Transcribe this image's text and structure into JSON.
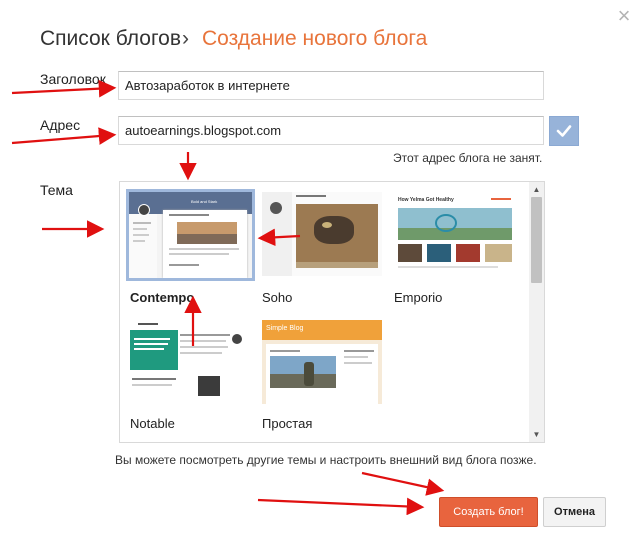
{
  "header": {
    "breadcrumb_root": "Список блогов",
    "separator": "›",
    "current_page": "Создание нового блога",
    "close_symbol": "×"
  },
  "form": {
    "title_label": "Заголовок",
    "title_value": "Автозаработок в интернете",
    "address_label": "Адрес",
    "address_value": "autoearnings.blogspot.com",
    "address_status": "Этот адрес блога не занят.",
    "theme_label": "Тема"
  },
  "themes": [
    {
      "name": "Contempo",
      "selected": true,
      "preview_title": "Bold and Stark"
    },
    {
      "name": "Soho",
      "selected": false,
      "preview_title": ""
    },
    {
      "name": "Emporio",
      "selected": false,
      "preview_title": "How Yelma Got Healthy"
    },
    {
      "name": "Notable",
      "selected": false,
      "preview_title": ""
    },
    {
      "name": "Простая",
      "selected": false,
      "preview_title": "Simple Blog"
    }
  ],
  "footer": {
    "note": "Вы можете посмотреть другие темы и настроить внешний вид блога позже.",
    "create_label": "Создать блог!",
    "cancel_label": "Отмена"
  },
  "colors": {
    "accent_orange": "#e8643e",
    "title_orange": "#e8743b",
    "annotation_red": "#e01010",
    "selected_border": "#9fb8dc",
    "check_button": "#97b3d9"
  },
  "icons": {
    "close": "close-icon",
    "check": "check-icon",
    "scroll_up": "scroll-up-icon",
    "scroll_down": "scroll-down-icon"
  }
}
